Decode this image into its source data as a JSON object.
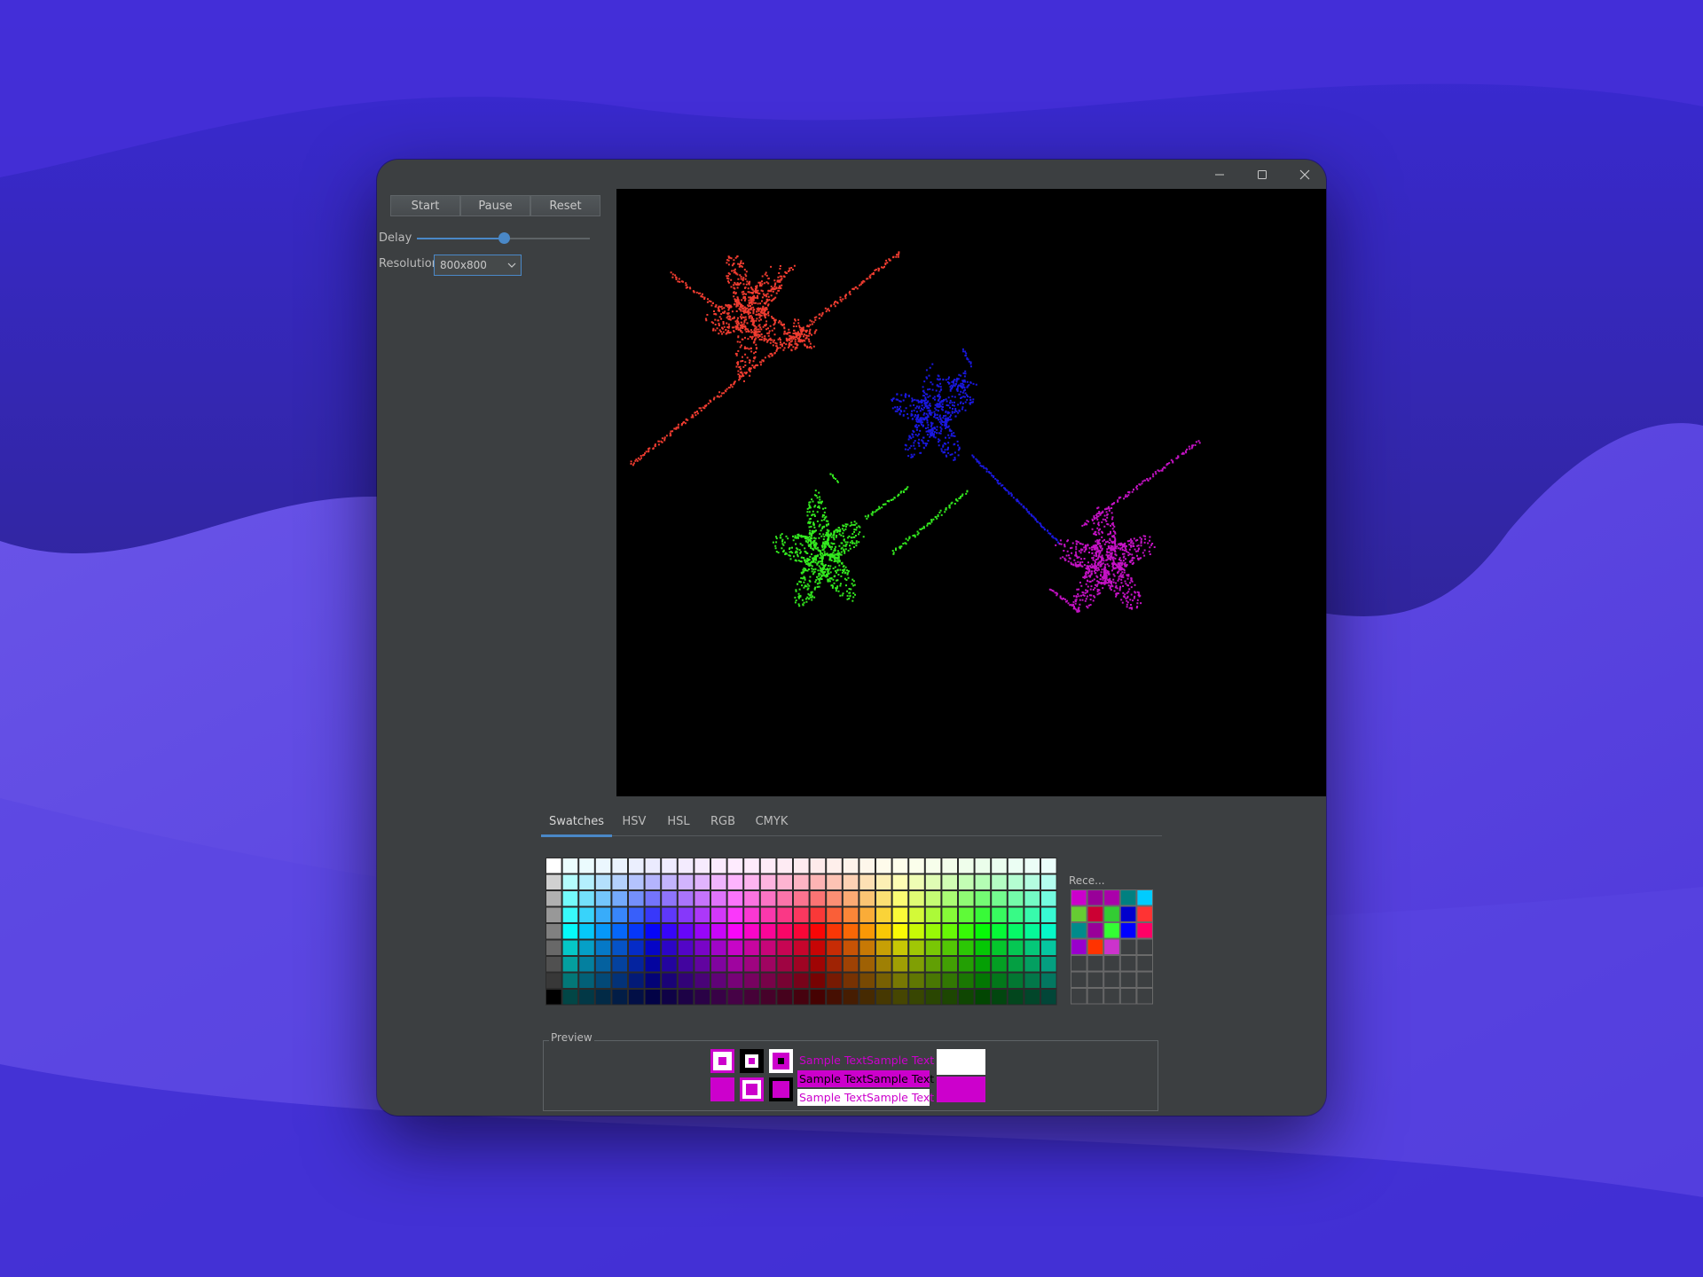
{
  "toolbar": {
    "start_label": "Start",
    "pause_label": "Pause",
    "reset_label": "Reset"
  },
  "controls": {
    "delay_label": "Delay",
    "delay_value_fraction": 0.5,
    "resolution_label": "Resolution",
    "resolution_value": "800x800"
  },
  "window_controls": {
    "minimize_icon": "minimize-icon",
    "maximize_icon": "maximize-icon",
    "close_icon": "close-icon"
  },
  "canvas": {
    "background": "#000000",
    "clusters": [
      {
        "name": "red",
        "color": "#f03c30"
      },
      {
        "name": "blue",
        "color": "#1a18e0"
      },
      {
        "name": "green",
        "color": "#33e81f"
      },
      {
        "name": "magenta",
        "color": "#c412c4"
      }
    ]
  },
  "color_chooser": {
    "tabs": [
      {
        "label": "Swatches",
        "selected": true
      },
      {
        "label": "HSV",
        "selected": false
      },
      {
        "label": "HSL",
        "selected": false
      },
      {
        "label": "RGB",
        "selected": false
      },
      {
        "label": "CMYK",
        "selected": false
      }
    ],
    "recent_label": "Rece...",
    "recent_colors": [
      "#cc00cc",
      "#990099",
      "#aa00aa",
      "#008080",
      "#00ccff",
      "#66cc33",
      "#cc0033",
      "#33cc33",
      "#0000cc",
      "#ff3333",
      "#008b8b",
      "#990099",
      "#33ff33",
      "#0000ff",
      "#ff0066",
      "#9900cc",
      "#ff3300",
      "#cc33cc"
    ],
    "preview": {
      "label": "Preview",
      "sample_text": "Sample Text",
      "selected_color": "#cc00cc"
    }
  }
}
